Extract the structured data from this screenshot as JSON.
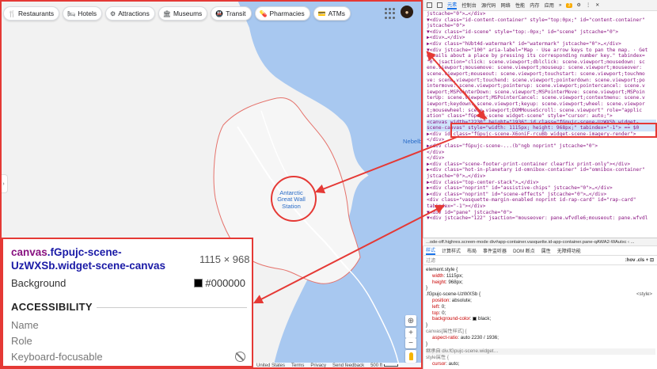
{
  "map": {
    "chips": [
      {
        "icon": "🍴",
        "icon_name": "restaurant-icon",
        "label": "Restaurants"
      },
      {
        "icon": "🛏",
        "icon_name": "hotel-icon",
        "label": "Hotels"
      },
      {
        "icon": "⚙",
        "icon_name": "attractions-icon",
        "label": "Attractions"
      },
      {
        "icon": "🏛",
        "icon_name": "museum-icon",
        "label": "Museums"
      },
      {
        "icon": "🚇",
        "icon_name": "transit-icon",
        "label": "Transit"
      },
      {
        "icon": "💊",
        "icon_name": "pharmacy-icon",
        "label": "Pharmacies"
      },
      {
        "icon": "💳",
        "icon_name": "atm-icon",
        "label": "ATMs"
      }
    ],
    "station_label": "Antarctic\nGreat Wall\nStation",
    "nebelbay_label": "Nebelba",
    "footer_links": [
      "United States",
      "Terms",
      "Privacy",
      "Send feedback",
      "500 ft"
    ],
    "colors": {
      "water": "#a8c8f0",
      "land": "#f2f2f2",
      "highlight": "#e53935",
      "boundary": "#e5736c"
    }
  },
  "tooltip": {
    "element_tag": "canvas",
    "element_class": ".fGpujc-scene-UzWXSb.widget-scene-canvas",
    "size": "1115 × 968",
    "background_label": "Background",
    "background_value": "#000000",
    "section_title": "ACCESSIBILITY",
    "name_label": "Name",
    "role_label": "Role",
    "keyboard_label": "Keyboard-focusable"
  },
  "devtools": {
    "tabs": [
      "元素",
      "控制台",
      "源代码",
      "网络",
      "性能",
      "内存",
      "应用",
      "»"
    ],
    "badge": "3",
    "dom_lines": [
      "jstcache=\"0\">…</div>",
      "▼<div class=\"id-content-container\" style=\"top:0px;\" id=\"content-container\"",
      "  jstcache=\"0\">",
      "  ▼<div class=\"id-scene\" style=\"top:-0px;\" id=\"scene\" jstcache=\"0\">",
      "    ▶<div>…</div>",
      "    ▶<div class=\"hUbt4d-watermark\" id=\"watermark\" jstcache=\"0\">…</div>",
      "    ▼<div jstcache=\"100\" aria-label=\"Map · Use arrow keys to pan the map. · Get",
      "      details about a place by pressing its corresponding number key.\" tabindex=",
      "      \"0\" jsaction=\"click: scene.viewport;dblclick: scene.viewport;mousedown: sc",
      "      ene.viewport;mousemove: scene.viewport;mouseup: scene.viewport;mouseover:",
      "      scene.viewport;mouseout: scene.viewport;touchstart: scene.viewport;touchmo",
      "      ve: scene.viewport;touchend: scene.viewport;pointerdown: scene.viewport;po",
      "      intermove: scene.viewport;pointerup: scene.viewport;pointercancel: scene.v",
      "      iewport;MSPointerDown: scene.viewport;MSPointerMove: scene.viewport;MSPoin",
      "      terUp: scene.viewport;MSPointerCancel: scene.viewport;contextmenu: scene.v",
      "      iewport;keydown: scene.viewport;keyup: scene.viewport;wheel: scene.viewpor",
      "      t;mousewheel: scene.viewport;DOMMouseScroll: scene.viewport\" role=\"applic",
      "      ation\" class=\"fGpujc-scene widget-scene\" style=\"cursor: auto;\">",
      "        <canvas width=\"2230\" height=\"1936\" id class=\"fGpujc-scene-UzWXSb widget-",
      "        scene-canvas\" style=\"width: 1115px; height: 968px;\" tabindex=\"-1\"> == $0",
      "      ▶<div id class=\"fGpujc-scene-X6oniF-rcuBb widget-scene-imagery-render\">",
      "        </div>",
      "      ▶<div class=\"fGpujc-scene-...(b\"ngb noprint\" jstcache=\"0\">",
      "    </div>",
      "  </div>",
      "  ▶<div class=\"scene-footer-print-container clearfix print-only\"></div>",
      "  ▶<div class=\"hot-in-planetary id-omnibox-container\" id=\"omnibox-container\"",
      "    jstcache=\"0\">…</div>",
      "  ▶<div class=\"top-center-stack\">…</div>",
      "  ▶<div class=\"noprint\" id=\"assistive-chips\" jstcache=\"0\">…</div>",
      "  ▶<div class=\"noprint\" id=\"scene-effects\" jstcache=\"0\">…</div>",
      "    <div class=\"vasquette-margin-enabled noprint id-rap-card\" id=\"rap-card\"",
      "    tabindex=\"-1\"></div>",
      "  ▼<div id=\"pane\" jstcache=\"0\">",
      "    ▼<div jstcache=\"122\" jsaction=\"mouseover: pane.wfvdle6;mouseout: pane.wfvdl"
    ],
    "selected_line_index": 18,
    "breadcrumb": "...ode-off.highres.screen-mode   div#app-container.vasquette.id-app-container.pane-qAWA2-WAutxc  ‹ ...",
    "subtabs": [
      "样式",
      "计算样式",
      "布局",
      "事件监听器",
      "DOM 断点",
      "属性",
      "无障碍功能"
    ],
    "filter_placeholder": "过滤",
    "filter_controls": ":hov  .cls  +  ⊡",
    "styles_lines": [
      {
        "kind": "selector",
        "text": "element.style {"
      },
      {
        "kind": "prop",
        "name": "width",
        "value": "1115px;"
      },
      {
        "kind": "prop",
        "name": "height",
        "value": "968px;"
      },
      {
        "kind": "close",
        "text": "}"
      },
      {
        "kind": "selector",
        "text": ".fGpujc-scene-UzWXSb {",
        "source": "<style>"
      },
      {
        "kind": "prop",
        "name": "position",
        "value": "absolute;"
      },
      {
        "kind": "prop",
        "name": "left",
        "value": "0;"
      },
      {
        "kind": "prop",
        "name": "top",
        "value": "0;"
      },
      {
        "kind": "prop-swatch",
        "name": "background-color",
        "value": "black;"
      },
      {
        "kind": "close",
        "text": "}"
      },
      {
        "kind": "gray",
        "text": "canvas[属性样式] {"
      },
      {
        "kind": "prop",
        "name": "aspect-ratio",
        "value": "auto 2230 / 1936;"
      },
      {
        "kind": "close",
        "text": "}"
      },
      {
        "kind": "inherit",
        "text": "继承自 div.fGpujc-scene.widget…"
      },
      {
        "kind": "gray",
        "text": "style属性 {"
      },
      {
        "kind": "prop",
        "name": "cursor",
        "value": "auto;"
      }
    ]
  }
}
